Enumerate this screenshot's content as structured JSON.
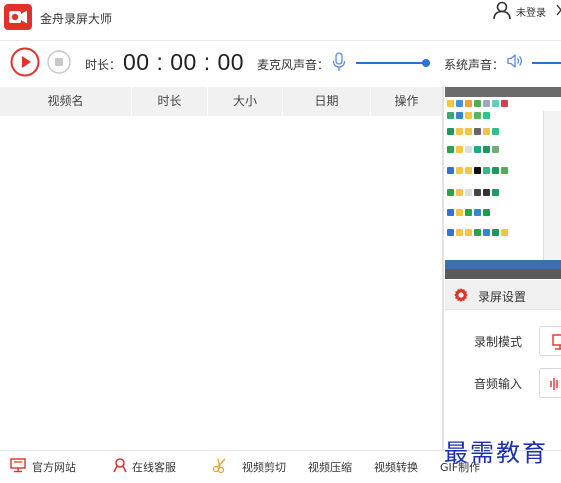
{
  "titlebar": {
    "app_name": "金舟录屏大师",
    "login_label": "未登录",
    "brand_color": "#e0312b"
  },
  "recbar": {
    "duration_label": "时长：",
    "duration_value": "00 : 00 : 00",
    "mic_label": "麦克风声音：",
    "system_label": "系统声音：",
    "accent_color": "#2f6fd6"
  },
  "table": {
    "columns": [
      "视频名",
      "时长",
      "大小",
      "日期",
      "操作"
    ],
    "rows": []
  },
  "settings": {
    "title": "录屏设置",
    "record_mode_label": "录制模式",
    "audio_input_label": "音频输入"
  },
  "bottombar": {
    "items": [
      {
        "label": "官方网站",
        "icon": "monitor-icon"
      },
      {
        "label": "在线客服",
        "icon": "user-service-icon"
      },
      {
        "label": "视频剪切",
        "icon": "scissors-icon"
      },
      {
        "label": "视频压缩",
        "icon": ""
      },
      {
        "label": "视频转换",
        "icon": ""
      },
      {
        "label": "GIF制作",
        "icon": ""
      }
    ]
  },
  "watermark": {
    "text": "最需教育"
  }
}
